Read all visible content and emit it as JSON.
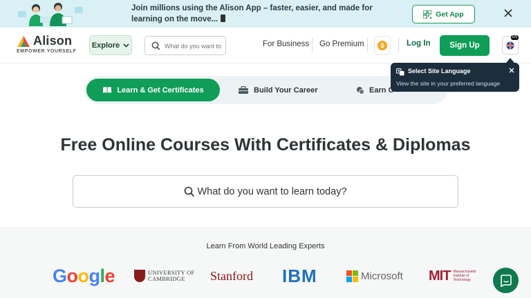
{
  "banner": {
    "message": "Join millions using the Alison App – faster, easier, and made for learning on the move...",
    "get_app_label": "Get App"
  },
  "header": {
    "logo_name": "Alison",
    "logo_tagline": "EMPOWER YOURSELF",
    "explore_label": "Explore",
    "search_placeholder": "What do you want to learn today?",
    "nav": {
      "business": "For Business",
      "premium": "Go Premium",
      "coin_symbol": "$",
      "login": "Log In",
      "signup": "Sign Up",
      "lang_badge": "EN"
    }
  },
  "tooltip": {
    "title": "Select Site Language",
    "body": "View the site in your preferred language"
  },
  "tabs": [
    {
      "label": "Learn & Get Certificates",
      "active": true
    },
    {
      "label": "Build Your Career",
      "active": false
    },
    {
      "label": "Earn C",
      "active": false
    }
  ],
  "hero": {
    "title": "Free Online Courses With Certificates & Diplomas",
    "search_placeholder": "What do you want to learn today?"
  },
  "partners": {
    "title": "Learn From World Leading Experts",
    "google": "Google",
    "cambridge_line1": "UNIVERSITY OF",
    "cambridge_line2": "CAMBRIDGE",
    "stanford": "Stanford",
    "ibm": "IBM",
    "microsoft": "Microsoft",
    "mit_mark": "MIT",
    "mit_line1": "Massachusetts",
    "mit_line2": "Institute of",
    "mit_line3": "Technology"
  },
  "colors": {
    "brand_green": "#0f9d58",
    "banner_bg": "#d9f1f4",
    "tooltip_bg": "#1c2d3d"
  }
}
